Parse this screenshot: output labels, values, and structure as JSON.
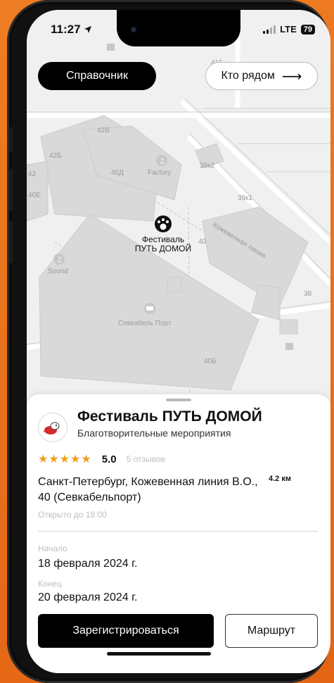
{
  "status_bar": {
    "time": "11:27",
    "network": "LTE",
    "battery": "79"
  },
  "top_buttons": {
    "directory": "Справочник",
    "nearby": "Кто рядом",
    "nearby_arrow": "⟶"
  },
  "map": {
    "pin_label_line1": "Фестиваль",
    "pin_label_line2": "ПУТЬ ДОМОЙ",
    "labels": [
      "41Б",
      "42В",
      "42Б",
      "42",
      "40Д",
      "40Е",
      "39к2",
      "39к1",
      "40",
      "38",
      "40Б",
      "Factory",
      "Sound",
      "Севкабель Порт",
      "Кожевенная линия"
    ],
    "building_color": "#d9d9d9",
    "road_color": "#ffffff"
  },
  "place": {
    "title": "Фестиваль ПУТЬ ДОМОЙ",
    "category": "Благотворительные мероприятия",
    "stars": "★★★★★",
    "rating": "5.0",
    "reviews": "5 отзывов",
    "address": "Санкт-Петербург, Кожевенная линия В.О., 40 (Севкабельпорт)",
    "distance": "4.2 км",
    "open_until": "Открыто до 18:00",
    "start_label": "Начало",
    "start_date": "18 февраля 2024 г.",
    "end_label": "Конец",
    "end_date": "20 февраля 2024 г."
  },
  "actions": {
    "register": "Зарегистрироваться",
    "route": "Маршрут"
  },
  "colors": {
    "accent_star": "#f29e1a",
    "frame_background": "#e8721c",
    "primary_button": "#000000"
  }
}
